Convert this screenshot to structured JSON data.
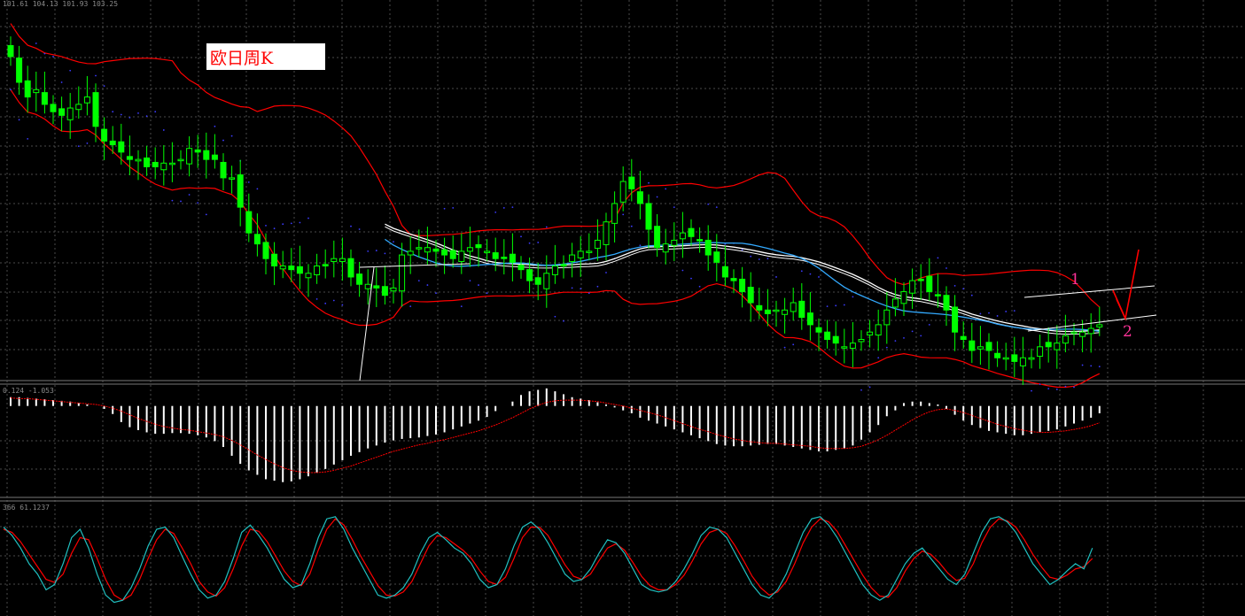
{
  "title_label": "欧日周K",
  "headers": {
    "main": "101.61 104.13 101.93 103.25",
    "macd": "0.124 -1.053",
    "stoch": "366 61.1237"
  },
  "annotations": [
    {
      "text": "1",
      "color": "#ff3399"
    },
    {
      "text": "2",
      "color": "#ff3399"
    }
  ],
  "colors": {
    "background": "#000000",
    "grid": "#4a4a4a",
    "candle": "#00ff00",
    "bollinger": "#ff0000",
    "sar": "#3c3cff",
    "ma_fast": "#33aaff",
    "ma_slow": "#ffffff",
    "macd_histogram": "#ffffff",
    "macd_signal": "#ff0000",
    "stoch_main": "#20c0c0",
    "stoch_signal": "#ff0000",
    "trend_arrow": "#ff0000"
  },
  "chart_data": [
    {
      "type": "candlestick",
      "indicators": [
        "bollinger",
        "parabolic_sar",
        "moving_average"
      ],
      "grid": true,
      "ylim": [
        96.0,
        106.0
      ],
      "close": [
        104.7,
        104.0,
        103.6,
        103.8,
        103.4,
        103.2,
        103.1,
        103.3,
        103.4,
        103.6,
        102.8,
        102.4,
        102.3,
        102.1,
        101.9,
        101.9,
        101.7,
        101.7,
        101.8,
        101.8,
        101.9,
        102.2,
        102.1,
        101.9,
        101.9,
        101.4,
        101.4,
        100.6,
        99.9,
        99.6,
        99.2,
        99.0,
        99.0,
        98.9,
        98.8,
        98.8,
        99.0,
        99.0,
        99.2,
        99.2,
        98.7,
        98.5,
        98.5,
        98.4,
        98.2,
        98.4,
        99.3,
        99.4,
        99.5,
        99.5,
        99.4,
        99.3,
        99.2,
        99.4,
        99.5,
        99.5,
        99.4,
        99.2,
        99.2,
        99.1,
        98.9,
        98.6,
        98.5,
        98.8,
        99.0,
        99.0,
        99.3,
        99.4,
        99.4,
        99.7,
        100.2,
        100.7,
        101.3,
        101.1,
        100.7,
        100.0,
        99.5,
        99.6,
        99.7,
        99.9,
        99.8,
        99.7,
        99.3,
        99.1,
        98.7,
        98.6,
        98.3,
        98.0,
        97.8,
        97.7,
        97.8,
        97.8,
        98.0,
        97.6,
        97.4,
        97.2,
        97.0,
        96.9,
        96.8,
        96.9,
        97.0,
        97.2,
        97.4,
        97.8,
        98.1,
        98.3,
        98.6,
        98.6,
        98.3,
        98.2,
        97.8,
        97.2,
        97.0,
        96.7,
        96.8,
        96.7,
        96.5,
        96.5,
        96.4,
        96.5,
        96.5,
        96.8,
        96.8,
        96.9,
        97.1,
        97.2,
        97.2,
        97.3,
        97.4
      ],
      "trendlines": [
        "upper",
        "lower",
        "white-projection"
      ]
    },
    {
      "type": "bar",
      "name_hint": "MACD",
      "ylim": [
        -1.2,
        0.25
      ],
      "values": [
        0.12,
        0.12,
        0.11,
        0.1,
        0.09,
        0.08,
        0.07,
        0.06,
        0.04,
        0.02,
        0.0,
        -0.04,
        -0.11,
        -0.22,
        -0.29,
        -0.33,
        -0.36,
        -0.38,
        -0.38,
        -0.37,
        -0.37,
        -0.38,
        -0.4,
        -0.43,
        -0.48,
        -0.56,
        -0.68,
        -0.79,
        -0.88,
        -0.94,
        -1.0,
        -1.02,
        -1.04,
        -1.03,
        -1.0,
        -0.96,
        -0.91,
        -0.86,
        -0.8,
        -0.74,
        -0.68,
        -0.63,
        -0.58,
        -0.54,
        -0.5,
        -0.47,
        -0.45,
        -0.44,
        -0.43,
        -0.41,
        -0.39,
        -0.36,
        -0.32,
        -0.28,
        -0.24,
        -0.2,
        -0.15,
        -0.07,
        0.0,
        0.06,
        0.15,
        0.2,
        0.22,
        0.24,
        0.2,
        0.16,
        0.12,
        0.1,
        0.08,
        0.05,
        0.02,
        -0.02,
        -0.06,
        -0.1,
        -0.16,
        -0.2,
        -0.24,
        -0.28,
        -0.32,
        -0.36,
        -0.4,
        -0.44,
        -0.48,
        -0.52,
        -0.54,
        -0.55,
        -0.55,
        -0.54,
        -0.53,
        -0.52,
        -0.52,
        -0.54,
        -0.56,
        -0.58,
        -0.6,
        -0.62,
        -0.62,
        -0.6,
        -0.58,
        -0.54,
        -0.46,
        -0.36,
        -0.26,
        -0.14,
        -0.06,
        0.04,
        0.06,
        0.06,
        0.04,
        0.02,
        -0.04,
        -0.12,
        -0.2,
        -0.26,
        -0.3,
        -0.34,
        -0.36,
        -0.38,
        -0.4,
        -0.4,
        -0.38,
        -0.36,
        -0.34,
        -0.32,
        -0.28,
        -0.24,
        -0.2,
        -0.16,
        -0.1
      ],
      "signal": [
        0.11,
        0.1,
        0.1,
        0.09,
        0.08,
        0.07,
        0.06,
        0.05,
        0.04,
        0.03,
        0.02,
        0.0,
        -0.03,
        -0.07,
        -0.12,
        -0.17,
        -0.21,
        -0.25,
        -0.28,
        -0.3,
        -0.32,
        -0.33,
        -0.35,
        -0.37,
        -0.39,
        -0.42,
        -0.47,
        -0.53,
        -0.6,
        -0.67,
        -0.73,
        -0.79,
        -0.84,
        -0.88,
        -0.9,
        -0.91,
        -0.91,
        -0.9,
        -0.88,
        -0.85,
        -0.82,
        -0.78,
        -0.74,
        -0.7,
        -0.66,
        -0.62,
        -0.59,
        -0.56,
        -0.53,
        -0.51,
        -0.48,
        -0.46,
        -0.43,
        -0.4,
        -0.37,
        -0.34,
        -0.3,
        -0.26,
        -0.21,
        -0.16,
        -0.1,
        -0.04,
        0.01,
        0.05,
        0.07,
        0.08,
        0.08,
        0.08,
        0.07,
        0.06,
        0.04,
        0.02,
        0.0,
        -0.03,
        -0.06,
        -0.09,
        -0.12,
        -0.16,
        -0.2,
        -0.24,
        -0.28,
        -0.32,
        -0.35,
        -0.39,
        -0.42,
        -0.45,
        -0.47,
        -0.49,
        -0.5,
        -0.51,
        -0.51,
        -0.52,
        -0.53,
        -0.54,
        -0.55,
        -0.57,
        -0.58,
        -0.58,
        -0.58,
        -0.57,
        -0.55,
        -0.51,
        -0.46,
        -0.4,
        -0.33,
        -0.26,
        -0.19,
        -0.13,
        -0.08,
        -0.05,
        -0.04,
        -0.06,
        -0.09,
        -0.13,
        -0.17,
        -0.21,
        -0.25,
        -0.28,
        -0.31,
        -0.33,
        -0.35,
        -0.36,
        -0.36,
        -0.35,
        -0.34,
        -0.32,
        -0.3,
        -0.27,
        -0.23
      ]
    },
    {
      "type": "line",
      "name_hint": "Stochastic",
      "ylim": [
        0,
        100
      ],
      "series": [
        {
          "values": [
            80,
            72,
            60,
            45,
            35,
            20,
            25,
            45,
            70,
            78,
            60,
            35,
            15,
            8,
            10,
            22,
            40,
            62,
            78,
            80,
            70,
            52,
            35,
            20,
            12,
            15,
            28,
            50,
            75,
            82,
            72,
            60,
            45,
            30,
            22,
            25,
            45,
            70,
            88,
            90,
            78,
            60,
            45,
            30,
            15,
            12,
            15,
            22,
            35,
            55,
            70,
            75,
            68,
            60,
            55,
            45,
            30,
            22,
            25,
            40,
            62,
            80,
            85,
            78,
            65,
            50,
            35,
            28,
            30,
            40,
            55,
            68,
            65,
            55,
            40,
            25,
            20,
            18,
            20,
            28,
            40,
            55,
            72,
            80,
            78,
            70,
            55,
            40,
            25,
            15,
            12,
            20,
            35,
            55,
            75,
            88,
            90,
            82,
            70,
            55,
            40,
            25,
            15,
            10,
            15,
            30,
            45,
            55,
            60,
            50,
            40,
            30,
            25,
            35,
            55,
            75,
            88,
            90,
            85,
            75,
            60,
            45,
            35,
            25,
            30,
            38,
            45,
            40,
            60
          ]
        },
        {
          "values": [
            78,
            75,
            66,
            54,
            42,
            30,
            27,
            35,
            55,
            70,
            68,
            50,
            30,
            15,
            10,
            15,
            30,
            50,
            68,
            78,
            74,
            60,
            45,
            28,
            18,
            14,
            22,
            40,
            62,
            78,
            76,
            66,
            52,
            38,
            28,
            24,
            35,
            58,
            78,
            88,
            82,
            68,
            52,
            38,
            24,
            15,
            14,
            18,
            28,
            45,
            62,
            72,
            70,
            64,
            58,
            50,
            38,
            28,
            25,
            32,
            50,
            70,
            80,
            80,
            72,
            58,
            44,
            33,
            30,
            35,
            48,
            60,
            64,
            58,
            46,
            33,
            24,
            20,
            20,
            25,
            34,
            48,
            64,
            75,
            78,
            74,
            62,
            48,
            33,
            22,
            15,
            18,
            28,
            45,
            65,
            80,
            88,
            85,
            76,
            62,
            48,
            34,
            22,
            14,
            13,
            22,
            38,
            50,
            57,
            54,
            46,
            36,
            29,
            31,
            45,
            65,
            80,
            88,
            86,
            80,
            68,
            54,
            42,
            32,
            30,
            34,
            40,
            42,
            50
          ]
        }
      ]
    }
  ]
}
